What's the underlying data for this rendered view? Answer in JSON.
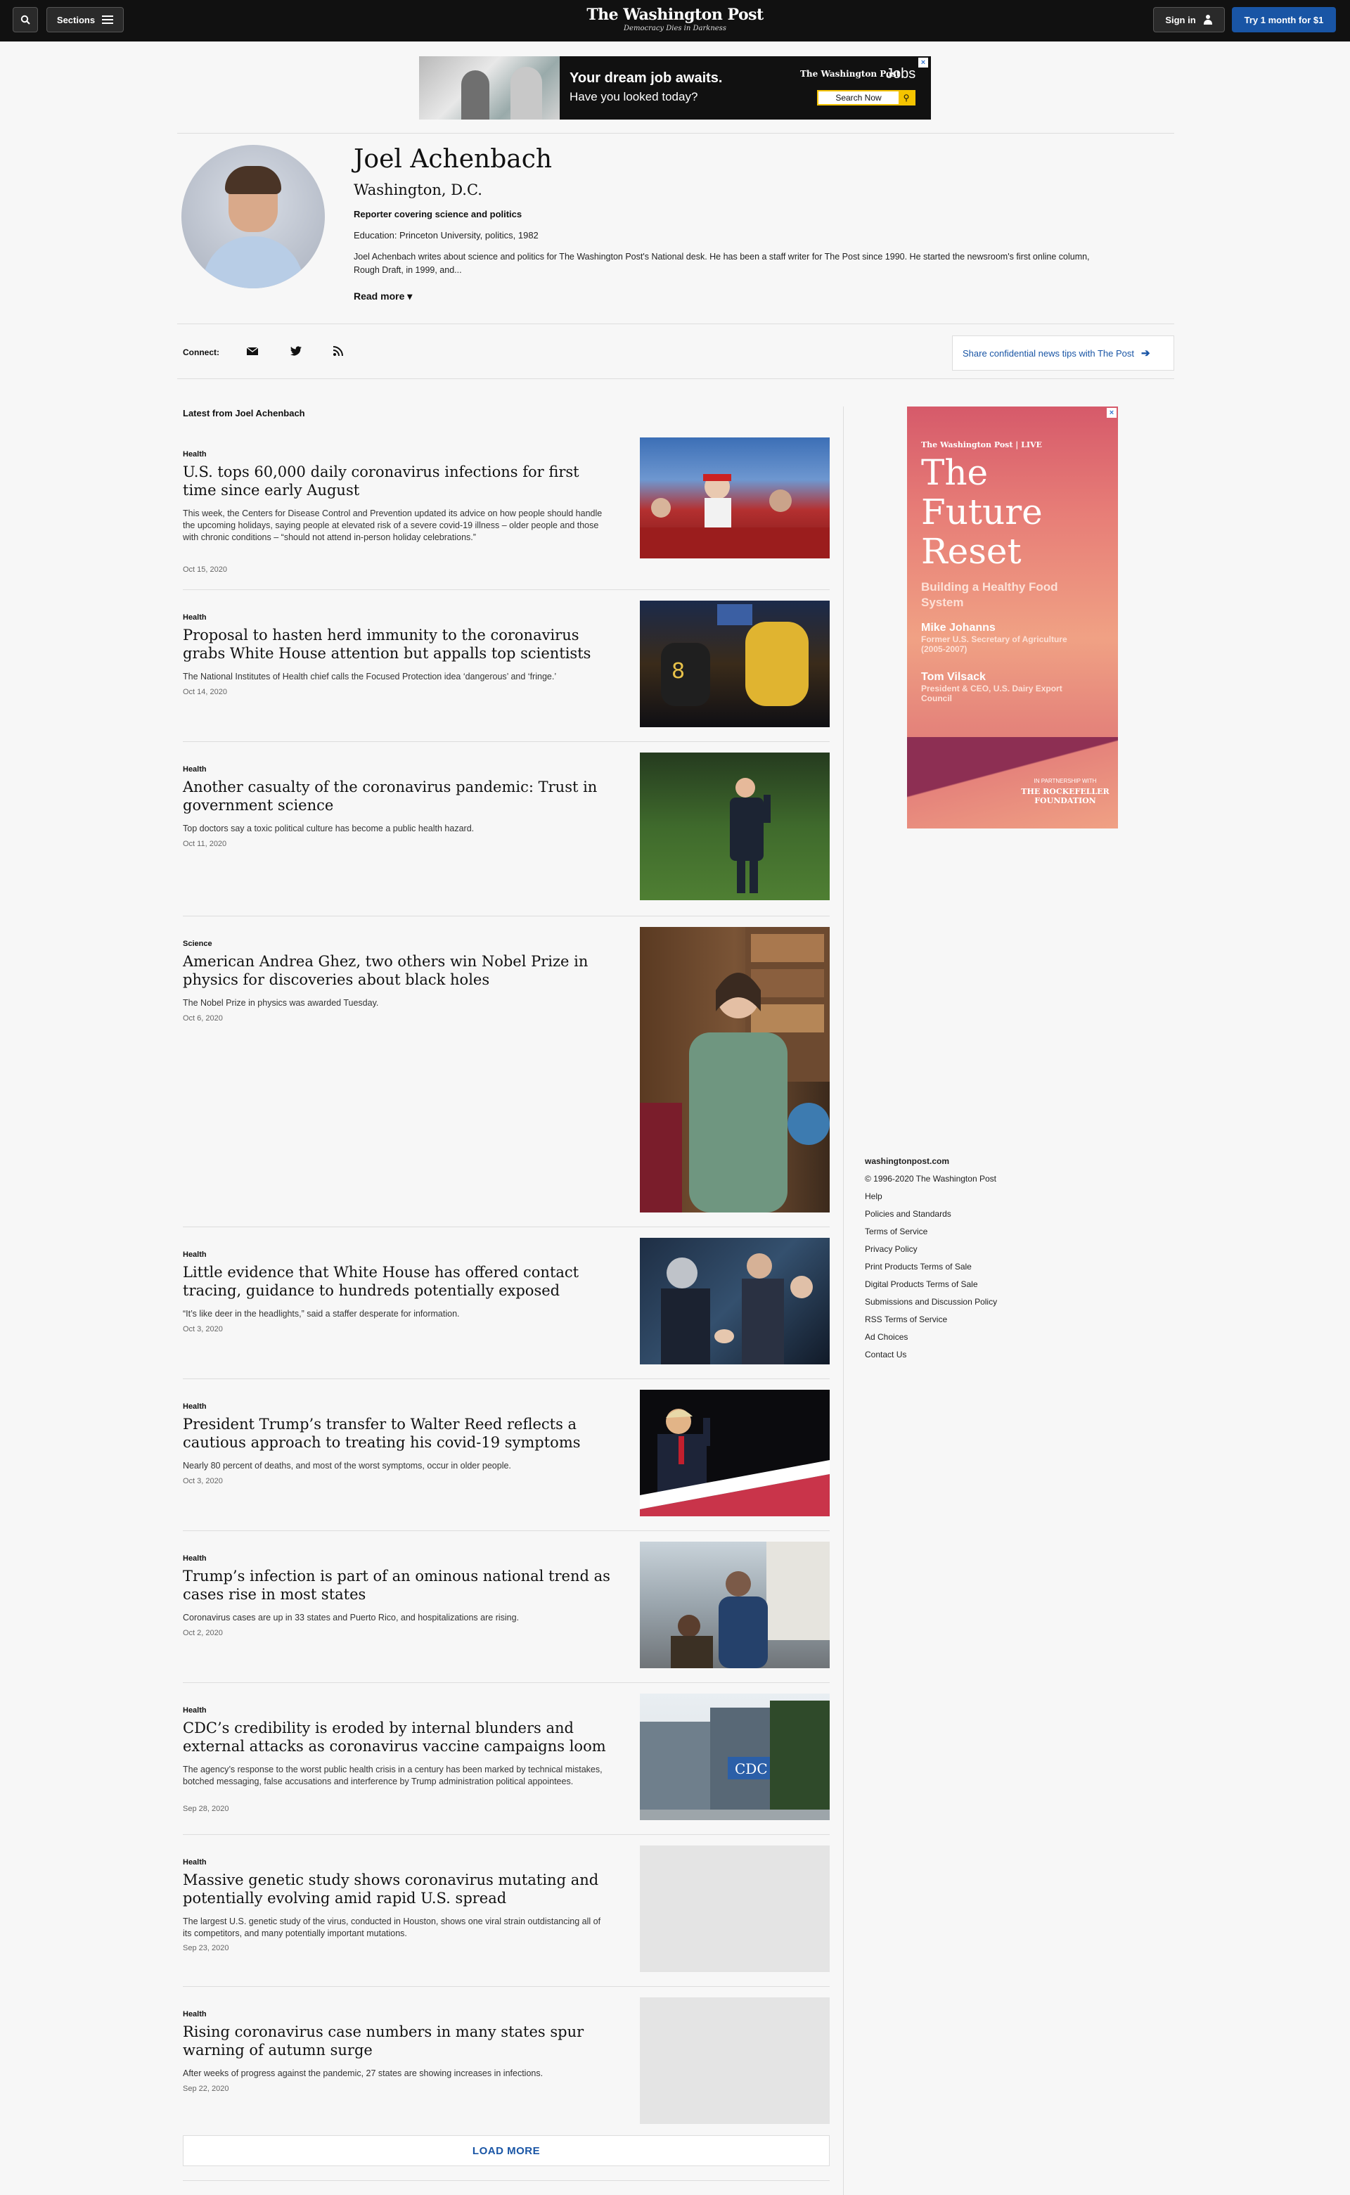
{
  "header": {
    "sections_label": "Sections",
    "logo_title": "The Washington Post",
    "logo_tagline": "Democracy Dies in Darkness",
    "signin_label": "Sign in",
    "try_label": "Try 1 month for $1"
  },
  "top_ad": {
    "headline": "Your dream job awaits.",
    "subline": "Have you looked today?",
    "brand": "The Washington Post",
    "jobs": "Jobs",
    "search_label": "Search Now"
  },
  "author": {
    "name": "Joel Achenbach",
    "location": "Washington, D.C.",
    "role": "Reporter covering science and politics",
    "education": "Education: Princeton University, politics, 1982",
    "bio": "Joel Achenbach writes about science and politics for The Washington Post's National desk. He has been a staff writer for The Post since 1990. He started the newsroom's first online column, Rough Draft, in 1999, and...",
    "read_more": "Read more"
  },
  "connect": {
    "label": "Connect:",
    "share_label": "Share confidential news tips with The Post"
  },
  "latest_heading": "Latest from Joel Achenbach",
  "articles": [
    {
      "category": "Health",
      "title": "U.S. tops 60,000 daily coronavirus infections for first time since early August",
      "blurb": "This week, the Centers for Disease Control and Prevention updated its advice on how people should handle the upcoming holidays, saying people at elevated risk of a severe covid-19 illness – older people and those with chronic conditions – “should not attend in-person holiday celebrations.”",
      "date": "Oct 15, 2020"
    },
    {
      "category": "Health",
      "title": "Proposal to hasten herd immunity to the coronavirus grabs White House attention but appalls top scientists",
      "blurb": "The National Institutes of Health chief calls the Focused Protection idea ‘dangerous’ and ‘fringe.’",
      "date": "Oct 14, 2020"
    },
    {
      "category": "Health",
      "title": "Another casualty of the coronavirus pandemic: Trust in government science",
      "blurb": "Top doctors say a toxic political culture has become a public health hazard.",
      "date": "Oct 11, 2020"
    },
    {
      "category": "Science",
      "title": "American Andrea Ghez, two others win Nobel Prize in physics for discoveries about black holes",
      "blurb": "The Nobel Prize in physics was awarded Tuesday.",
      "date": "Oct 6, 2020"
    },
    {
      "category": "Health",
      "title": "Little evidence that White House has offered contact tracing, guidance to hundreds potentially exposed",
      "blurb": "“It’s like deer in the headlights,” said a staffer desperate for information.",
      "date": "Oct 3, 2020"
    },
    {
      "category": "Health",
      "title": "President Trump’s transfer to Walter Reed reflects a cautious approach to treating his covid-19 symptoms",
      "blurb": "Nearly 80 percent of deaths, and most of the worst symptoms, occur in older people.",
      "date": "Oct 3, 2020"
    },
    {
      "category": "Health",
      "title": "Trump’s infection is part of an ominous national trend as cases rise in most states",
      "blurb": "Coronavirus cases are up in 33 states and Puerto Rico, and hospitalizations are rising.",
      "date": "Oct 2, 2020"
    },
    {
      "category": "Health",
      "title": "CDC’s credibility is eroded by internal blunders and external attacks as coronavirus vaccine campaigns loom",
      "blurb": "The agency’s response to the worst public health crisis in a century has been marked by technical mistakes, botched messaging, false accusations and interference by Trump administration political appointees.",
      "date": "Sep 28, 2020"
    },
    {
      "category": "Health",
      "title": "Massive genetic study shows coronavirus mutating and potentially evolving amid rapid U.S. spread",
      "blurb": "The largest U.S. genetic study of the virus, conducted in Houston, shows one viral strain outdistancing all of its competitors, and many potentially important mutations.",
      "date": "Sep 23, 2020"
    },
    {
      "category": "Health",
      "title": "Rising coronavirus case numbers in many states spur warning of autumn surge",
      "blurb": "After weeks of progress against the pandemic, 27 states are showing increases in infections.",
      "date": "Sep 22, 2020"
    }
  ],
  "load_more": "LOAD MORE",
  "right_ad": {
    "brand": "The Washington Post",
    "live": "LIVE",
    "title": "The Future Reset",
    "subtitle": "Building a Healthy Food System",
    "p1_name": "Mike Johanns",
    "p1_role": "Former U.S. Secretary of Agriculture (2005-2007)",
    "p2_name": "Tom Vilsack",
    "p2_role": "President & CEO, U.S. Dairy Export Council",
    "partner": "IN PARTNERSHIP WITH",
    "partner_name": "THE ROCKEFELLER FOUNDATION"
  },
  "footer": {
    "site": "washingtonpost.com",
    "copyright": "© 1996-2020 The Washington Post",
    "links": [
      "Help",
      "Policies and Standards",
      "Terms of Service",
      "Privacy Policy",
      "Print Products Terms of Sale",
      "Digital Products Terms of Sale",
      "Submissions and Discussion Policy",
      "RSS Terms of Service",
      "Ad Choices",
      "Contact Us"
    ]
  }
}
